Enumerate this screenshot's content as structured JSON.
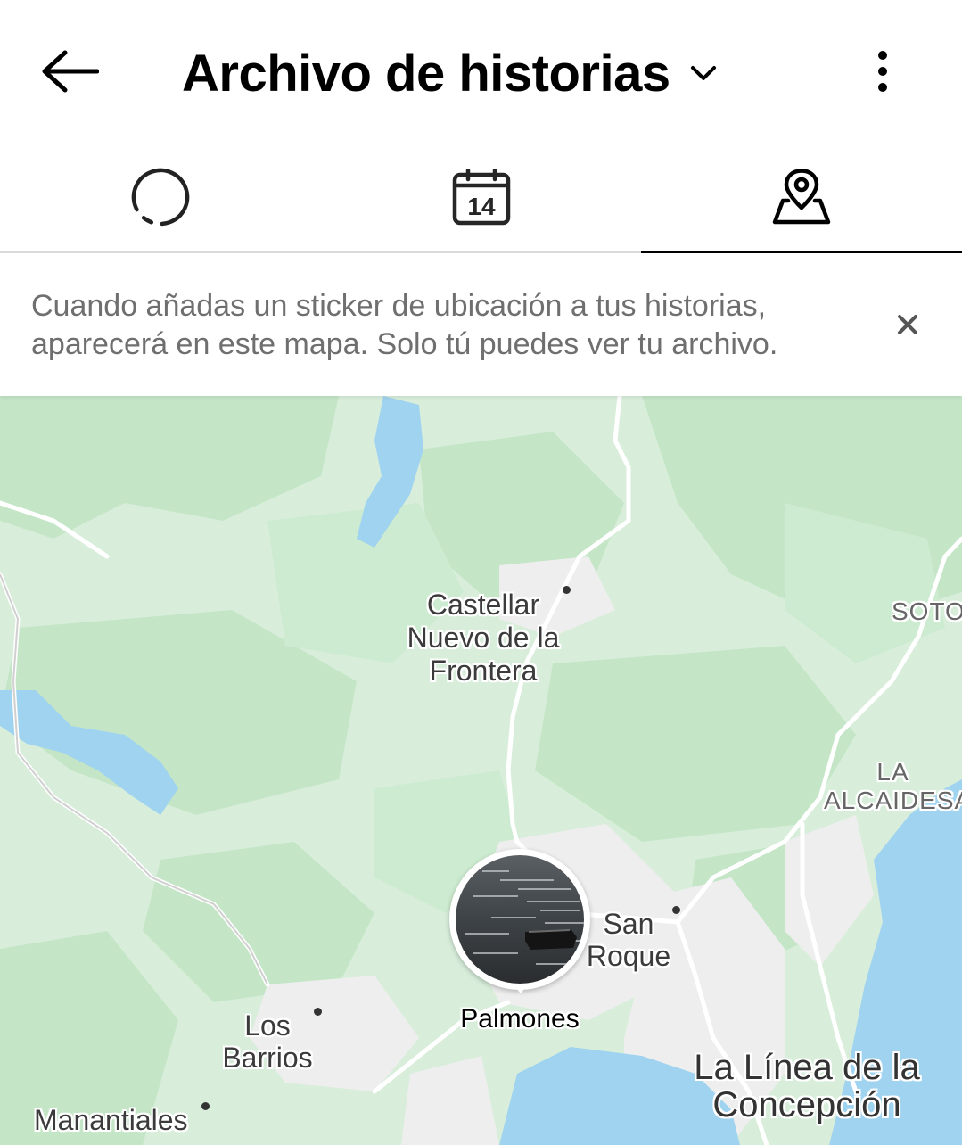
{
  "header": {
    "back_icon": "arrow-left-icon",
    "title": "Archivo de historias",
    "title_caret_icon": "chevron-down-icon",
    "more_icon": "more-vertical-icon"
  },
  "tabs": [
    {
      "name": "stories",
      "icon": "dashed-circle-icon",
      "active": false
    },
    {
      "name": "calendar",
      "icon": "calendar-icon",
      "calendar_day": "14",
      "active": false
    },
    {
      "name": "map",
      "icon": "map-pin-icon",
      "active": true
    }
  ],
  "notice": {
    "text": "Cuando añadas un sticker de ubicación a tus historias, aparecerá en este mapa. Solo tú puedes ver tu archivo.",
    "close_icon": "close-icon"
  },
  "map": {
    "labels": {
      "castellar": "Castellar Nuevo de la Frontera",
      "soto": "SOTOG",
      "la_alcaidesa": "LA ALCAIDESA",
      "san_roque": "San Roque",
      "los_barrios": "Los Barrios",
      "la_linea": "La Línea de la Concepción",
      "manantiales": "Manantiales"
    },
    "pin": {
      "label": "Palmones"
    },
    "colors": {
      "land": "#d8eedb",
      "forest": "#bfe3c3",
      "water": "#9fd3f0",
      "urban": "#eeeeee",
      "road": "#ffffff"
    }
  }
}
